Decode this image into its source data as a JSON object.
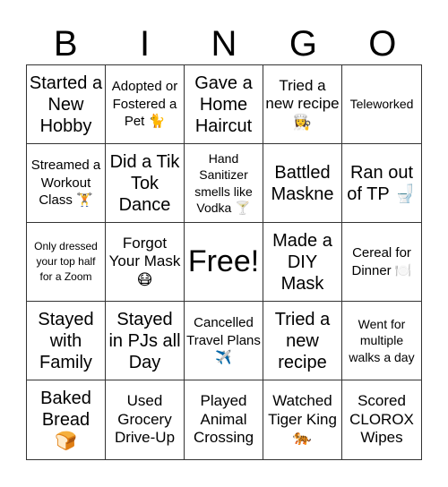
{
  "header": {
    "letters": [
      "B",
      "I",
      "N",
      "G",
      "O"
    ]
  },
  "board": {
    "cells": [
      {
        "text": "Started a New Hobby",
        "size": "lg"
      },
      {
        "text": "Adopted or Fostered a Pet 🐈",
        "size": "sm"
      },
      {
        "text": "Gave a Home Haircut",
        "size": "lg"
      },
      {
        "text": "Tried a new recipe 👩‍🍳",
        "size": "md"
      },
      {
        "text": "Teleworked",
        "size": "xs"
      },
      {
        "text": "Streamed a Workout Class 🏋️",
        "size": "sm"
      },
      {
        "text": "Did a Tik Tok Dance",
        "size": "lg"
      },
      {
        "text": "Hand Sanitizer smells like Vodka 🍸",
        "size": "xs"
      },
      {
        "text": "Battled Maskne",
        "size": "lg"
      },
      {
        "text": "Ran out of TP 🚽",
        "size": "lg"
      },
      {
        "text": "Only dressed your top half for a Zoom",
        "size": "xxs"
      },
      {
        "text": "Forgot Your Mask 😷",
        "size": "md"
      },
      {
        "text": "Free!",
        "size": "xl",
        "free": true
      },
      {
        "text": "Made a DIY Mask",
        "size": "lg"
      },
      {
        "text": "Cereal for Dinner 🍽️",
        "size": "sm"
      },
      {
        "text": "Stayed with Family",
        "size": "lg"
      },
      {
        "text": "Stayed in PJs all Day",
        "size": "lg"
      },
      {
        "text": "Cancelled Travel Plans ✈️",
        "size": "sm"
      },
      {
        "text": "Tried a new recipe",
        "size": "lg"
      },
      {
        "text": "Went for multiple walks a day",
        "size": "xs"
      },
      {
        "text": "Baked Bread 🍞",
        "size": "lg"
      },
      {
        "text": "Used Grocery Drive-Up",
        "size": "md"
      },
      {
        "text": "Played Animal Crossing",
        "size": "md"
      },
      {
        "text": "Watched Tiger King 🐅",
        "size": "md"
      },
      {
        "text": "Scored CLOROX Wipes",
        "size": "md"
      }
    ]
  }
}
